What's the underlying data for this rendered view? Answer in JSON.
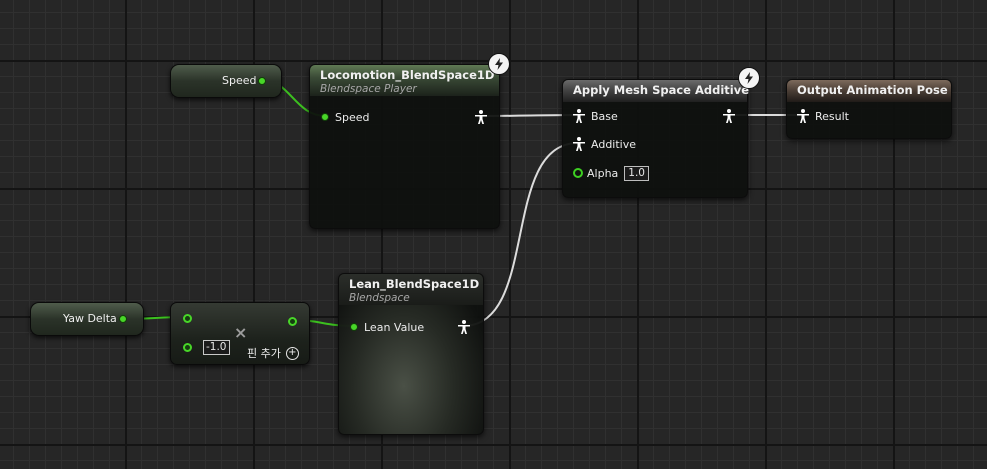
{
  "graph": {
    "variables": {
      "speed": {
        "label": "Speed"
      },
      "yaw_delta": {
        "label": "Yaw Delta"
      }
    },
    "multiply_node": {
      "operator_symbol": "×",
      "b_value": "-1.0",
      "add_pin_label": "핀 추가",
      "add_pin_icon": "plus-circle-icon"
    },
    "locomotion_node": {
      "title": "Locomotion_BlendSpace1D",
      "subtitle": "Blendspace Player",
      "input_label": "Speed",
      "badge_icon": "lightning-icon"
    },
    "lean_node": {
      "title": "Lean_BlendSpace1D",
      "subtitle": "Blendspace",
      "input_label": "Lean Value"
    },
    "additive_node": {
      "title": "Apply Mesh Space Additive",
      "base_label": "Base",
      "additive_label": "Additive",
      "alpha_label": "Alpha",
      "alpha_value": "1.0",
      "badge_icon": "lightning-icon"
    },
    "output_node": {
      "title": "Output Animation Pose",
      "result_label": "Result"
    }
  },
  "colors": {
    "float_pin": "#48d628",
    "pose_pin": "#ffffff",
    "graph_background": "#262626",
    "blendspace_header": "#5f7a54",
    "output_header": "#7d6a5c"
  }
}
